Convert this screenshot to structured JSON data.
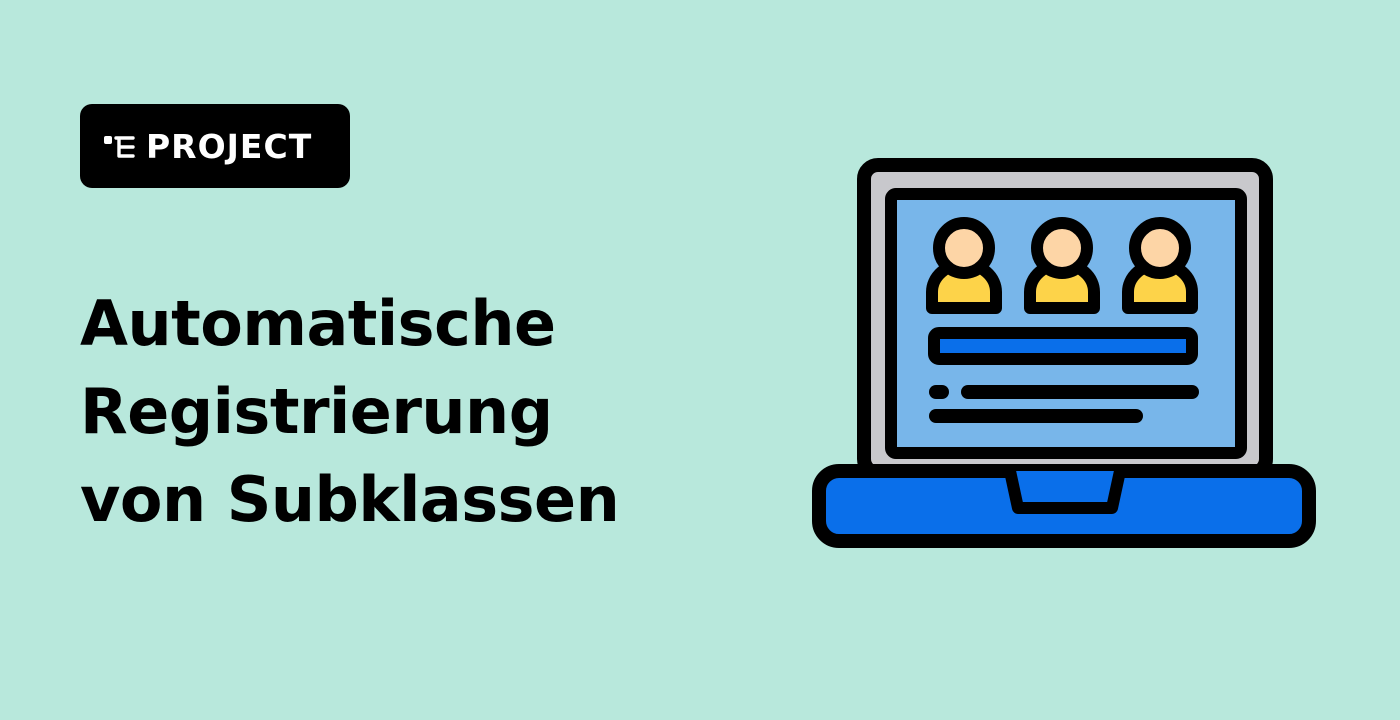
{
  "badge": {
    "label": "PROJECT",
    "icon": "hierarchy-icon"
  },
  "title": {
    "lines": [
      "Automatische",
      "Registrierung",
      "von Subklassen"
    ]
  },
  "illustration": {
    "icon": "laptop-users-icon"
  },
  "colors": {
    "background": "#b8e8dc",
    "badge_background": "#000000",
    "badge_text": "#ffffff",
    "title_text": "#000000",
    "laptop_frame": "#c8c8cc",
    "laptop_screen": "#78b6ea",
    "laptop_base": "#0a6fea",
    "face": "#fdd5a6",
    "body": "#fdd349",
    "outline": "#000000"
  }
}
